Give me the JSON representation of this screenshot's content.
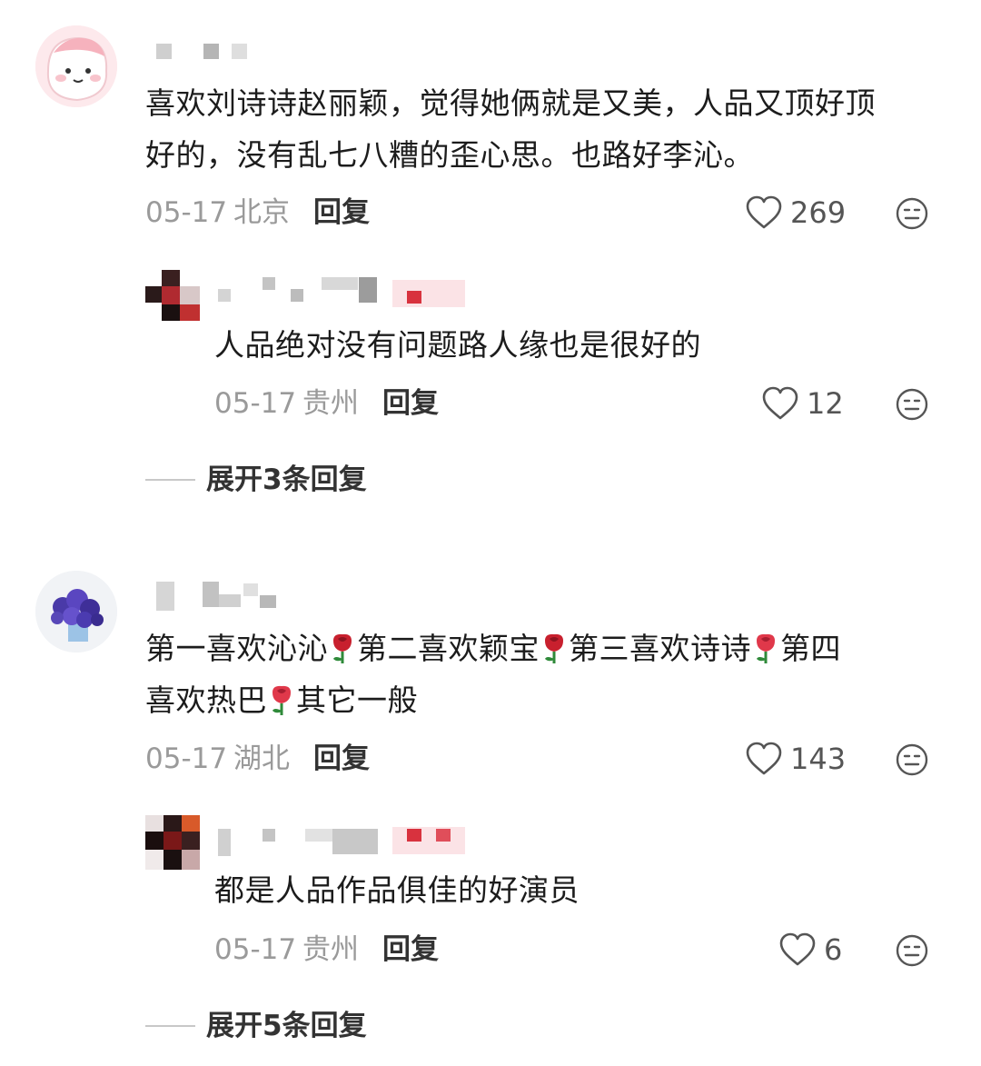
{
  "comments": [
    {
      "text_line1": "喜欢刘诗诗赵丽颖，觉得她俩就是又美，人品又顶好顶",
      "text_line2": "好的，没有乱七八糟的歪心思。也路好李沁。",
      "date": "05-17",
      "location": "北京",
      "reply_label": "回复",
      "likes": "269",
      "avatar_icon": "cartoon-pink-avatar-icon",
      "reply": {
        "text": "人品绝对没有问题路人缘也是很好的",
        "date": "05-17",
        "location": "贵州",
        "reply_label": "回复",
        "likes": "12"
      },
      "expand_label": "展开3条回复"
    },
    {
      "segments": [
        "第一喜欢沁沁",
        "第二喜欢颖宝",
        "第三喜欢诗诗",
        "第四",
        "喜欢热巴",
        "其它一般"
      ],
      "date": "05-17",
      "location": "湖北",
      "reply_label": "回复",
      "likes": "143",
      "avatar_icon": "blue-flowers-avatar-icon",
      "emoji": "rose-emoji",
      "reply": {
        "text": "都是人品作品俱佳的好演员",
        "date": "05-17",
        "location": "贵州",
        "reply_label": "回复",
        "likes": "6"
      },
      "expand_label": "展开5条回复"
    }
  ],
  "colors": {
    "meta_gray": "#9a9a9a",
    "rose_red": "#d8283a",
    "divider": "#c8c8c8"
  }
}
